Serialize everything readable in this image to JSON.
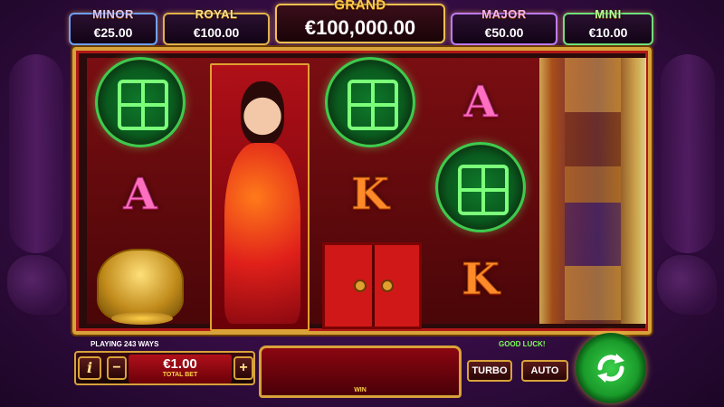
{
  "jackpots": {
    "minor": {
      "name": "MINOR",
      "value": "€25.00"
    },
    "royal": {
      "name": "ROYAL",
      "value": "€100.00"
    },
    "grand": {
      "name": "GRAND",
      "value": "€100,000.00"
    },
    "major": {
      "name": "MAJOR",
      "value": "€50.00"
    },
    "mini": {
      "name": "MINI",
      "value": "€10.00"
    }
  },
  "reels": {
    "col1": [
      "coin-symbol",
      "A",
      "frog-symbol"
    ],
    "col2": [
      "lady-symbol"
    ],
    "col3": [
      "coin-symbol",
      "K",
      "doors-symbol"
    ],
    "col4": [
      "A",
      "coin-symbol",
      "K"
    ],
    "col5": [
      "spinning"
    ]
  },
  "status": {
    "ways": "PLAYING 243 WAYS",
    "message": "GOOD LUCK!"
  },
  "controls": {
    "info_label": "i",
    "minus_label": "−",
    "plus_label": "+",
    "bet_value": "€1.00",
    "bet_label": "TOTAL BET",
    "win_label": "WIN",
    "turbo_label": "TURBO",
    "auto_label": "AUTO"
  },
  "icons": {
    "info": "info-icon",
    "spin": "spin-arrows-icon"
  },
  "colors": {
    "gold_border": "#d8a23a",
    "spin_green": "#1a9a2a",
    "good_luck_text": "#7cff5a",
    "background_purple": "#3a0e4a"
  }
}
